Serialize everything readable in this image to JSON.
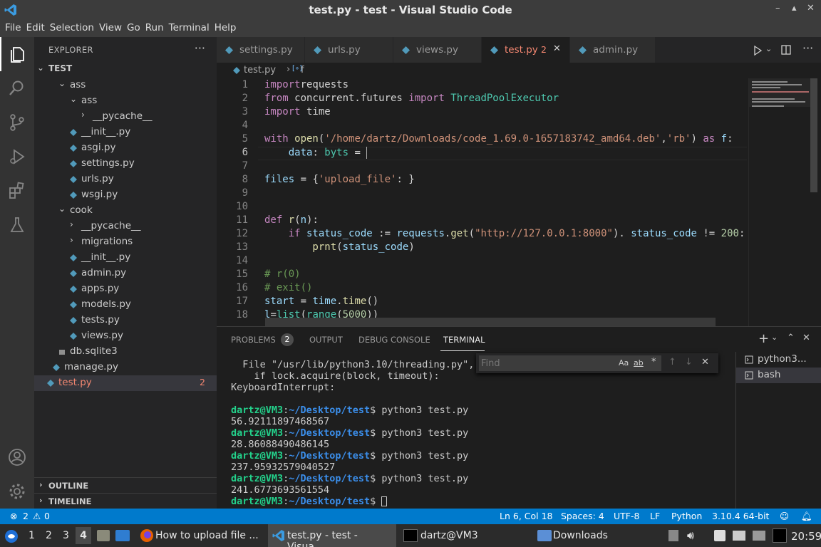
{
  "window": {
    "title": "test.py - test - Visual Studio Code",
    "controls": [
      "–",
      "▴",
      "✕"
    ]
  },
  "menu": [
    "File",
    "Edit",
    "Selection",
    "View",
    "Go",
    "Run",
    "Terminal",
    "Help"
  ],
  "explorer": {
    "heading": "EXPLORER",
    "root": "TEST",
    "tree": [
      {
        "label": "ass",
        "type": "folder",
        "open": true
      },
      {
        "label": "ass",
        "type": "folder",
        "open": true
      },
      {
        "label": "__pycache__",
        "type": "folder",
        "open": false
      },
      {
        "label": "__init__.py",
        "type": "py"
      },
      {
        "label": "asgi.py",
        "type": "py"
      },
      {
        "label": "settings.py",
        "type": "py"
      },
      {
        "label": "urls.py",
        "type": "py"
      },
      {
        "label": "wsgi.py",
        "type": "py"
      },
      {
        "label": "cook",
        "type": "folder",
        "open": true
      },
      {
        "label": "__pycache__",
        "type": "folder",
        "open": false
      },
      {
        "label": "migrations",
        "type": "folder",
        "open": false
      },
      {
        "label": "__init__.py",
        "type": "py"
      },
      {
        "label": "admin.py",
        "type": "py"
      },
      {
        "label": "apps.py",
        "type": "py"
      },
      {
        "label": "models.py",
        "type": "py"
      },
      {
        "label": "tests.py",
        "type": "py"
      },
      {
        "label": "views.py",
        "type": "py"
      },
      {
        "label": "db.sqlite3",
        "type": "db"
      },
      {
        "label": "manage.py",
        "type": "py"
      },
      {
        "label": "test.py",
        "type": "py",
        "errors": "2"
      }
    ],
    "outline": "OUTLINE",
    "timeline": "TIMELINE"
  },
  "tabs": [
    {
      "label": "settings.py"
    },
    {
      "label": "urls.py"
    },
    {
      "label": "views.py"
    },
    {
      "label": "test.py",
      "badge": "2",
      "active": true,
      "close": "✕"
    },
    {
      "label": "admin.py"
    }
  ],
  "breadcrumb": {
    "file": "test.py",
    "sep": "›",
    "symbol_icon": "[∘]",
    "symbol": "f"
  },
  "code_lines": [
    {
      "n": "1",
      "t": [
        [
          "kw",
          "import"
        ],
        [
          "",
          "requests"
        ]
      ]
    },
    {
      "n": "2",
      "t": [
        [
          "kw",
          "from"
        ],
        [
          "",
          " concurrent.futures "
        ],
        [
          "kw",
          "import"
        ],
        [
          "cls",
          " ThreadPoolExecutor"
        ]
      ]
    },
    {
      "n": "3",
      "t": [
        [
          "kw",
          "import"
        ],
        [
          "",
          " time"
        ]
      ]
    },
    {
      "n": "4",
      "t": []
    },
    {
      "n": "5",
      "t": [
        [
          "kw",
          "with"
        ],
        [
          "fn",
          " open"
        ],
        [
          "",
          "("
        ],
        [
          "str",
          "'/home/dartz/Downloads/code_1.69.0-1657183742_amd64.deb'"
        ],
        [
          "",
          ","
        ],
        [
          "str",
          "'rb'"
        ],
        [
          "",
          ") "
        ],
        [
          "kw",
          "as"
        ],
        [
          "var",
          " f"
        ],
        [
          "",
          ":"
        ]
      ]
    },
    {
      "n": "6",
      "t": [
        [
          "var",
          "    data"
        ],
        [
          "",
          ": "
        ],
        [
          "cls",
          "byts"
        ],
        [
          "",
          " = "
        ]
      ]
    },
    {
      "n": "7",
      "t": []
    },
    {
      "n": "8",
      "t": [
        [
          "var",
          "files"
        ],
        [
          "",
          " = {"
        ],
        [
          "str",
          "'upload_file'"
        ],
        [
          "",
          ": }"
        ]
      ]
    },
    {
      "n": "9",
      "t": []
    },
    {
      "n": "10",
      "t": []
    },
    {
      "n": "11",
      "t": [
        [
          "kw",
          "def"
        ],
        [
          "fn",
          " r"
        ],
        [
          "",
          "("
        ],
        [
          "var",
          "n"
        ],
        [
          "",
          "):"
        ]
      ]
    },
    {
      "n": "12",
      "t": [
        [
          "kw",
          "    if"
        ],
        [
          "var",
          " status_code"
        ],
        [
          "",
          " := "
        ],
        [
          "var",
          "requests"
        ],
        [
          "",
          "."
        ],
        [
          "fn",
          "get"
        ],
        [
          "",
          "("
        ],
        [
          "str",
          "\"http://127.0.0.1:8000\""
        ],
        [
          "",
          "). "
        ],
        [
          "var",
          "status_code"
        ],
        [
          "",
          " != "
        ],
        [
          "num",
          "200"
        ],
        [
          "",
          ":"
        ]
      ]
    },
    {
      "n": "13",
      "t": [
        [
          "fn",
          "        prnt"
        ],
        [
          "",
          "("
        ],
        [
          "var",
          "status_code"
        ],
        [
          "",
          ")"
        ]
      ]
    },
    {
      "n": "14",
      "t": []
    },
    {
      "n": "15",
      "t": [
        [
          "cm",
          "# r(0)"
        ]
      ]
    },
    {
      "n": "16",
      "t": [
        [
          "cm",
          "# exit()"
        ]
      ]
    },
    {
      "n": "17",
      "t": [
        [
          "var",
          "start"
        ],
        [
          "",
          " = "
        ],
        [
          "var",
          "time"
        ],
        [
          "",
          "."
        ],
        [
          "fn",
          "time"
        ],
        [
          "",
          "()"
        ]
      ]
    },
    {
      "n": "18",
      "t": [
        [
          "var",
          "l"
        ],
        [
          "",
          "="
        ],
        [
          "cls",
          "list"
        ],
        [
          "",
          "("
        ],
        [
          "cls",
          "range"
        ],
        [
          "",
          "("
        ],
        [
          "num",
          "5000"
        ],
        [
          "",
          "))"
        ]
      ]
    }
  ],
  "panel": {
    "tabs": [
      "PROBLEMS",
      "OUTPUT",
      "DEBUG CONSOLE",
      "TERMINAL"
    ],
    "problems_count": "2",
    "find_placeholder": "Find",
    "find_opts": [
      "Aa",
      "ab",
      "*"
    ]
  },
  "terminal_lines": [
    {
      "kind": "text",
      "text": "  File \"/usr/lib/python3.10/threading.py\", "
    },
    {
      "kind": "text",
      "text": "    if lock.acquire(block, timeout):"
    },
    {
      "kind": "text",
      "text": "KeyboardInterrupt:"
    },
    {
      "kind": "text",
      "text": ""
    },
    {
      "kind": "prompt",
      "user": "dartz@VM3",
      "path": "~/Desktop/test",
      "cmd": "python3 test.py"
    },
    {
      "kind": "text",
      "text": "56.92111897468567"
    },
    {
      "kind": "prompt",
      "user": "dartz@VM3",
      "path": "~/Desktop/test",
      "cmd": "python3 test.py"
    },
    {
      "kind": "text",
      "text": "28.86088490486145"
    },
    {
      "kind": "prompt",
      "user": "dartz@VM3",
      "path": "~/Desktop/test",
      "cmd": "python3 test.py"
    },
    {
      "kind": "text",
      "text": "237.95932579040527"
    },
    {
      "kind": "prompt",
      "user": "dartz@VM3",
      "path": "~/Desktop/test",
      "cmd": "python3 test.py"
    },
    {
      "kind": "text",
      "text": "241.6773693561554"
    },
    {
      "kind": "prompt",
      "user": "dartz@VM3",
      "path": "~/Desktop/test",
      "cmd": ""
    }
  ],
  "terminals": [
    "python3...",
    "bash"
  ],
  "status": {
    "errors": "2",
    "warnings": "0",
    "position": "Ln 6, Col 18",
    "spaces": "Spaces: 4",
    "encoding": "UTF-8",
    "eol": "LF",
    "language": "Python",
    "interpreter": "3.10.4 64-bit"
  },
  "taskbar": {
    "workspaces": [
      "1",
      "2",
      "3",
      "4"
    ],
    "apps": [
      "How to upload file ...",
      "test.py - test - Visua...",
      "dartz@VM3",
      "Downloads"
    ],
    "clock": "20:59"
  },
  "colors": {
    "accent": "#007acc",
    "error": "#f48771",
    "python_blue": "#519aba"
  }
}
